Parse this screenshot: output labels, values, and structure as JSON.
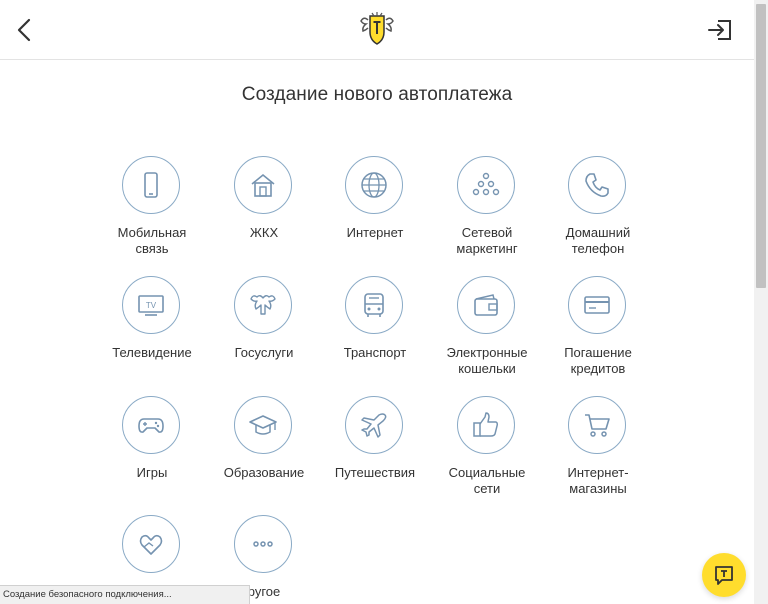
{
  "header": {
    "back_icon": "chevron-left-icon",
    "logo_icon": "bank-coat-of-arms-logo",
    "logout_icon": "logout-icon"
  },
  "page_title": "Создание нового автоплатежа",
  "categories": [
    {
      "label": "Мобильная\nсвязь",
      "icon": "mobile-phone-icon"
    },
    {
      "label": "ЖКХ",
      "icon": "house-icon"
    },
    {
      "label": "Интернет",
      "icon": "globe-icon"
    },
    {
      "label": "Сетевой\nмаркетинг",
      "icon": "network-icon"
    },
    {
      "label": "Домашний\nтелефон",
      "icon": "handset-icon"
    },
    {
      "label": "Телевидение",
      "icon": "tv-icon"
    },
    {
      "label": "Госуслуги",
      "icon": "eagle-emblem-icon"
    },
    {
      "label": "Транспорт",
      "icon": "bus-icon"
    },
    {
      "label": "Электронные\nкошельки",
      "icon": "wallet-icon"
    },
    {
      "label": "Погашение\nкредитов",
      "icon": "card-icon"
    },
    {
      "label": "Игры",
      "icon": "gamepad-icon"
    },
    {
      "label": "Образование",
      "icon": "graduation-cap-icon"
    },
    {
      "label": "Путешествия",
      "icon": "airplane-icon"
    },
    {
      "label": "Социальные\nсети",
      "icon": "thumbs-up-icon"
    },
    {
      "label": "Интернет-\nмагазины",
      "icon": "shopping-cart-icon"
    },
    {
      "label": "",
      "icon": "heart-hands-icon"
    },
    {
      "label": "ругое",
      "icon": "more-dots-icon"
    }
  ],
  "status_bar": "Создание безопасного подключения...",
  "chat_button": {
    "icon": "chat-icon",
    "color": "#ffdd2d"
  },
  "colors": {
    "icon_stroke": "#8aaac6",
    "icon_glyph": "#7593b0"
  }
}
